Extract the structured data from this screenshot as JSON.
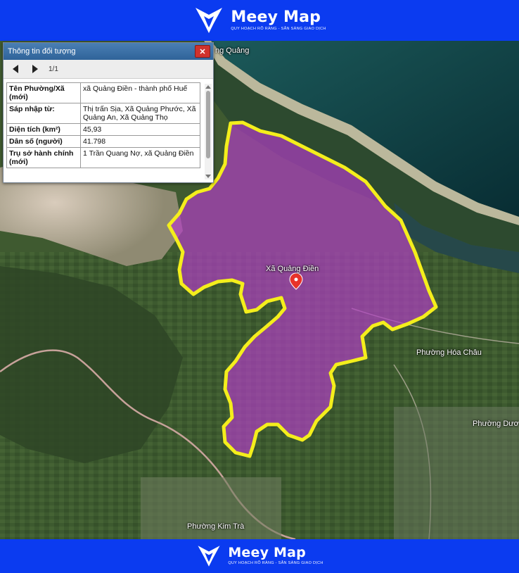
{
  "brand": {
    "name": "Meey Map",
    "tagline": "QUY HOẠCH RÕ RÀNG - SẴN SÀNG GIAO DỊCH"
  },
  "popup": {
    "title": "Thông tin đối tượng",
    "close_label": "✕",
    "pager": "1/1",
    "rows": [
      {
        "key": "Tên Phường/Xã (mới)",
        "value": "xã Quảng Điền - thành phố Huế"
      },
      {
        "key": "Sáp nhập từ:",
        "value": "Thị trấn Sịa, Xã Quảng Phước, Xã Quảng An, Xã Quảng Thọ"
      },
      {
        "key": "Diện tích (km²)",
        "value": "45,93"
      },
      {
        "key": "Dân số (người)",
        "value": "41.798"
      },
      {
        "key": "Trụ sở hành chính (mới)",
        "value": "1 Trần Quang Nợ, xã Quảng Điền"
      }
    ]
  },
  "map": {
    "labels": {
      "commune": "Xã Quảng Điền",
      "hoa_chau": "Phường Hóa Châu",
      "duong_no": "Phường Dươ",
      "kim_tra": "Phường Kim Trà",
      "quang": "ng Quảng"
    },
    "colors": {
      "highlight_fill": "#b43cc8",
      "highlight_border": "#f4ee1c",
      "pin": "#e8332a",
      "sea": "#0d3f47"
    }
  }
}
